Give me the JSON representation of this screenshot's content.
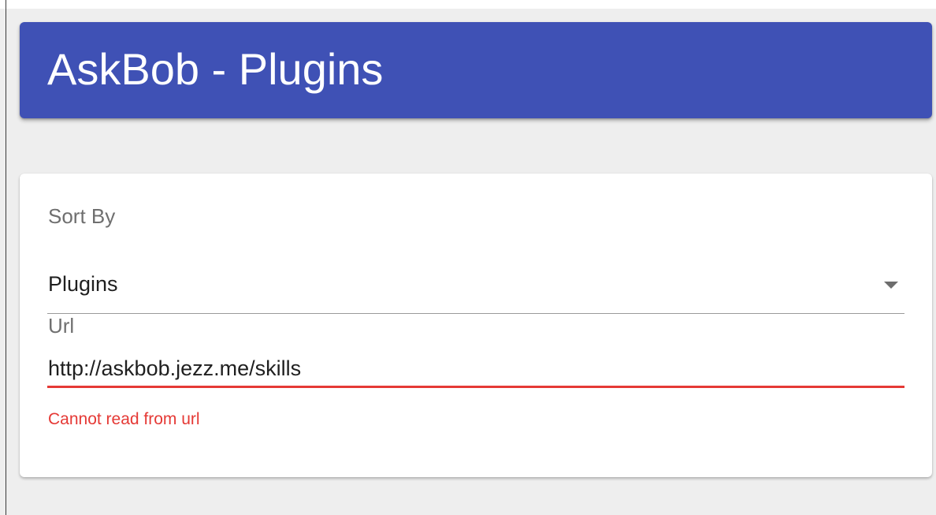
{
  "header": {
    "title": "AskBob - Plugins"
  },
  "sort_field": {
    "label": "Sort By",
    "selected": "Plugins"
  },
  "url_field": {
    "label": "Url",
    "value": "http://askbob.jezz.me/skills",
    "error": "Cannot read from url"
  },
  "icons": {
    "dropdown": "chevron-down-icon"
  },
  "colors": {
    "header_background": "#3f51b5",
    "header_text": "#ffffff",
    "page_background": "#eeeeee",
    "card_background": "#ffffff",
    "error": "#e53935"
  }
}
